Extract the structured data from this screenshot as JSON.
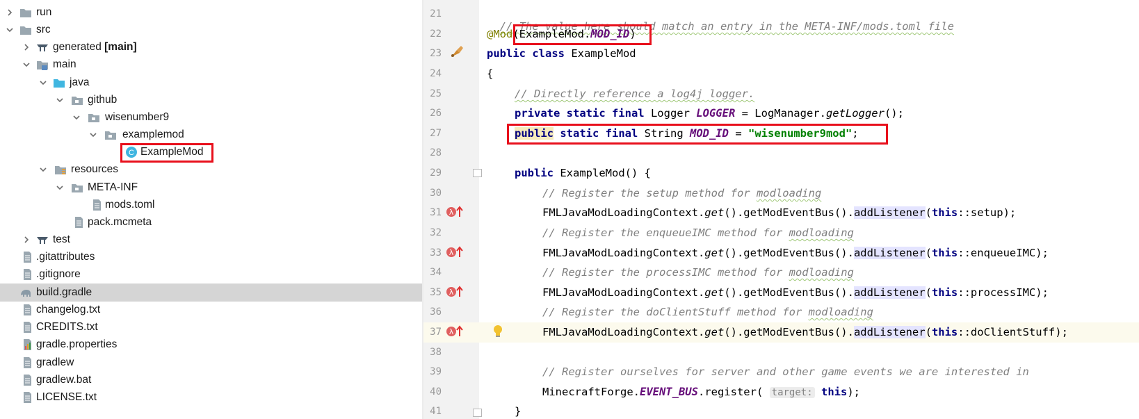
{
  "project_tree": {
    "items": [
      {
        "label": "run",
        "type": "folder"
      },
      {
        "label": "src",
        "type": "folder"
      },
      {
        "label": "generated",
        "suffix": "[main]",
        "type": "source-root"
      },
      {
        "label": "main",
        "type": "module-folder"
      },
      {
        "label": "java",
        "type": "source-folder"
      },
      {
        "label": "github",
        "type": "package"
      },
      {
        "label": "wisenumber9",
        "type": "package"
      },
      {
        "label": "examplemod",
        "type": "package"
      },
      {
        "label": "ExampleMod",
        "type": "class"
      },
      {
        "label": "resources",
        "type": "resources-folder"
      },
      {
        "label": "META-INF",
        "type": "package"
      },
      {
        "label": "mods.toml",
        "type": "file"
      },
      {
        "label": "pack.mcmeta",
        "type": "file"
      },
      {
        "label": "test",
        "type": "source-root"
      },
      {
        "label": ".gitattributes",
        "type": "file"
      },
      {
        "label": ".gitignore",
        "type": "file"
      },
      {
        "label": "build.gradle",
        "type": "gradle-file"
      },
      {
        "label": "changelog.txt",
        "type": "file"
      },
      {
        "label": "CREDITS.txt",
        "type": "file"
      },
      {
        "label": "gradle.properties",
        "type": "properties-file"
      },
      {
        "label": "gradlew",
        "type": "file"
      },
      {
        "label": "gradlew.bat",
        "type": "file"
      },
      {
        "label": "LICENSE.txt",
        "type": "file"
      }
    ]
  },
  "editor": {
    "line_numbers": [
      "21",
      "22",
      "23",
      "24",
      "25",
      "26",
      "27",
      "28",
      "29",
      "30",
      "31",
      "32",
      "33",
      "34",
      "35",
      "36",
      "37",
      "38",
      "39",
      "40",
      "41"
    ],
    "lines": {
      "l21": {
        "comment": "// The value here should match an entry in the META-INF/mods.toml file"
      },
      "l22": {
        "ann": "@Mod",
        "open": "(",
        "cls": "ExampleMod",
        "dot": ".",
        "const": "MOD_ID",
        "close": ")"
      },
      "l23": {
        "kw": "public class",
        "name": " ExampleMod"
      },
      "l24": {
        "brace": "{"
      },
      "l25": {
        "comment": "// Directly reference a log4j logger."
      },
      "l26": {
        "kw": "private static final",
        "type": " Logger ",
        "const": "LOGGER",
        "eq": " = LogManager.",
        "method": "getLogger",
        "end": "();"
      },
      "l27": {
        "kw1": "public",
        "kw2": " static final",
        "type": " String ",
        "const": "MOD_ID",
        "eq": " = ",
        "str": "\"wisenumber9mod\"",
        "end": ";"
      },
      "l29": {
        "kw": "public",
        "rest": " ExampleMod() {"
      },
      "l30": {
        "comment": "// Register the setup method for ",
        "comment_typo": "modloading"
      },
      "l31": {
        "pre": "FMLJavaModLoadingContext.",
        "get": "get",
        "mid": "().getModEventBus().",
        "call": "addListener",
        "open": "(",
        "this": "this",
        "ref": "::setup);"
      },
      "l32": {
        "comment": "// Register the enqueueIMC method for ",
        "comment_typo": "modloading"
      },
      "l33": {
        "pre": "FMLJavaModLoadingContext.",
        "get": "get",
        "mid": "().getModEventBus().",
        "call": "addListener",
        "open": "(",
        "this": "this",
        "ref": "::enqueueIMC);"
      },
      "l34": {
        "comment": "// Register the processIMC method for ",
        "comment_typo": "modloading"
      },
      "l35": {
        "pre": "FMLJavaModLoadingContext.",
        "get": "get",
        "mid": "().getModEventBus().",
        "call": "addListener",
        "open": "(",
        "this": "this",
        "ref": "::processIMC);"
      },
      "l36": {
        "comment": "// Register the doClientStuff method for ",
        "comment_typo": "modloading"
      },
      "l37": {
        "pre": "FMLJavaModLoadingContext.",
        "get": "get",
        "mid": "().getModEventBus().",
        "call": "addListener",
        "open": "(",
        "this": "this",
        "ref": "::doClientStuff);"
      },
      "l39": {
        "comment": "// Register ourselves for server and other game events we are interested in"
      },
      "l40": {
        "pre": "MinecraftForge.",
        "const": "EVENT_BUS",
        "mid": ".register( ",
        "hint": "target:",
        "this": " this",
        "end": ");"
      },
      "l41": {
        "brace": "}"
      }
    }
  },
  "colors": {
    "highlight_box": "#e8101c",
    "selection": "#d5d5d5",
    "keyword": "#000080",
    "string": "#008000",
    "constant": "#660e7a",
    "comment": "#808080",
    "annotation": "#808000",
    "current_line": "#fcfaed"
  },
  "icons": {
    "tree_chevron": "chevron-icon",
    "folder": "folder-icon",
    "package": "package-icon",
    "class": "java-class-icon",
    "file": "text-file-icon",
    "gradle": "gradle-elephant-icon",
    "gutter_bean": "implemented-bean-icon",
    "gutter_lambda": "lambda-override-icon",
    "intention": "lightbulb-icon"
  }
}
